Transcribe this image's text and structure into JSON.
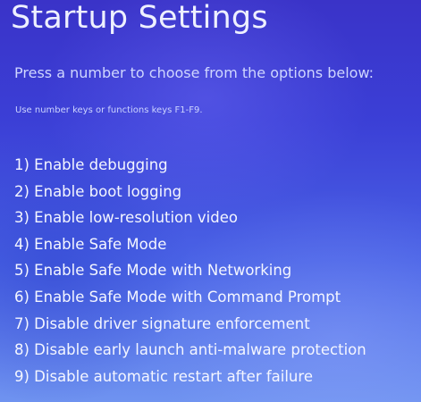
{
  "screen": {
    "title": "Startup Settings",
    "subtitle": "Press a number to choose from the options below:",
    "hint": "Use number keys or functions keys F1-F9."
  },
  "options": [
    {
      "label": "1) Enable debugging"
    },
    {
      "label": "2) Enable boot logging"
    },
    {
      "label": "3) Enable low-resolution video"
    },
    {
      "label": "4) Enable Safe Mode"
    },
    {
      "label": "5) Enable Safe Mode with Networking"
    },
    {
      "label": "6) Enable Safe Mode with Command Prompt"
    },
    {
      "label": "7) Disable driver signature enforcement"
    },
    {
      "label": "8) Disable early launch anti-malware protection"
    },
    {
      "label": "9) Disable automatic restart after failure"
    }
  ],
  "colors": {
    "background": "#3b3fd6",
    "text": "#ffffff"
  }
}
